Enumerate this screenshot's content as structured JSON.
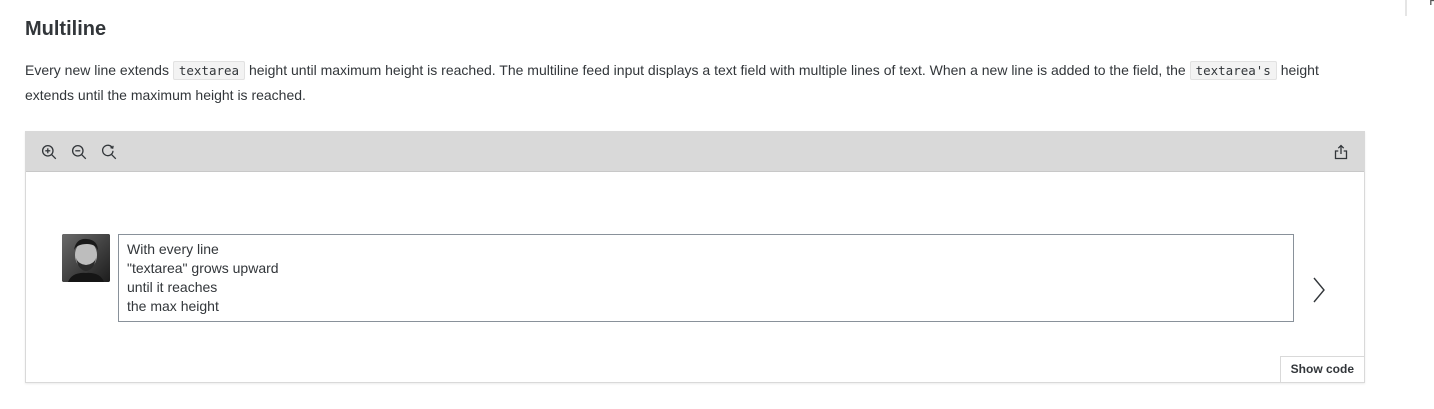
{
  "page": {
    "section_title": "Multiline",
    "description": {
      "part1": "Every new line extends ",
      "code1": "textarea",
      "part2": " height until maximum height is reached. The multiline feed input displays a text field with multiple lines of text. When a new line is added to the field, the ",
      "code2": "textarea's",
      "part3": " height extends until the maximum height is reached."
    },
    "right_edge_letter": "F"
  },
  "toolbar": {
    "icons": [
      "zoom-in-icon",
      "zoom-out-icon",
      "reset-zoom-icon",
      "share-icon"
    ]
  },
  "feed_input": {
    "value": "With every line\n\"textarea\" grows upward\nuntil it reaches\nthe max height"
  },
  "post_button": {
    "icon": "chevron-right-icon"
  },
  "footer": {
    "show_code_label": "Show code"
  },
  "colors": {
    "toolbar_bg": "#d9d9d9",
    "input_border": "#89919a",
    "text": "#32363a"
  }
}
